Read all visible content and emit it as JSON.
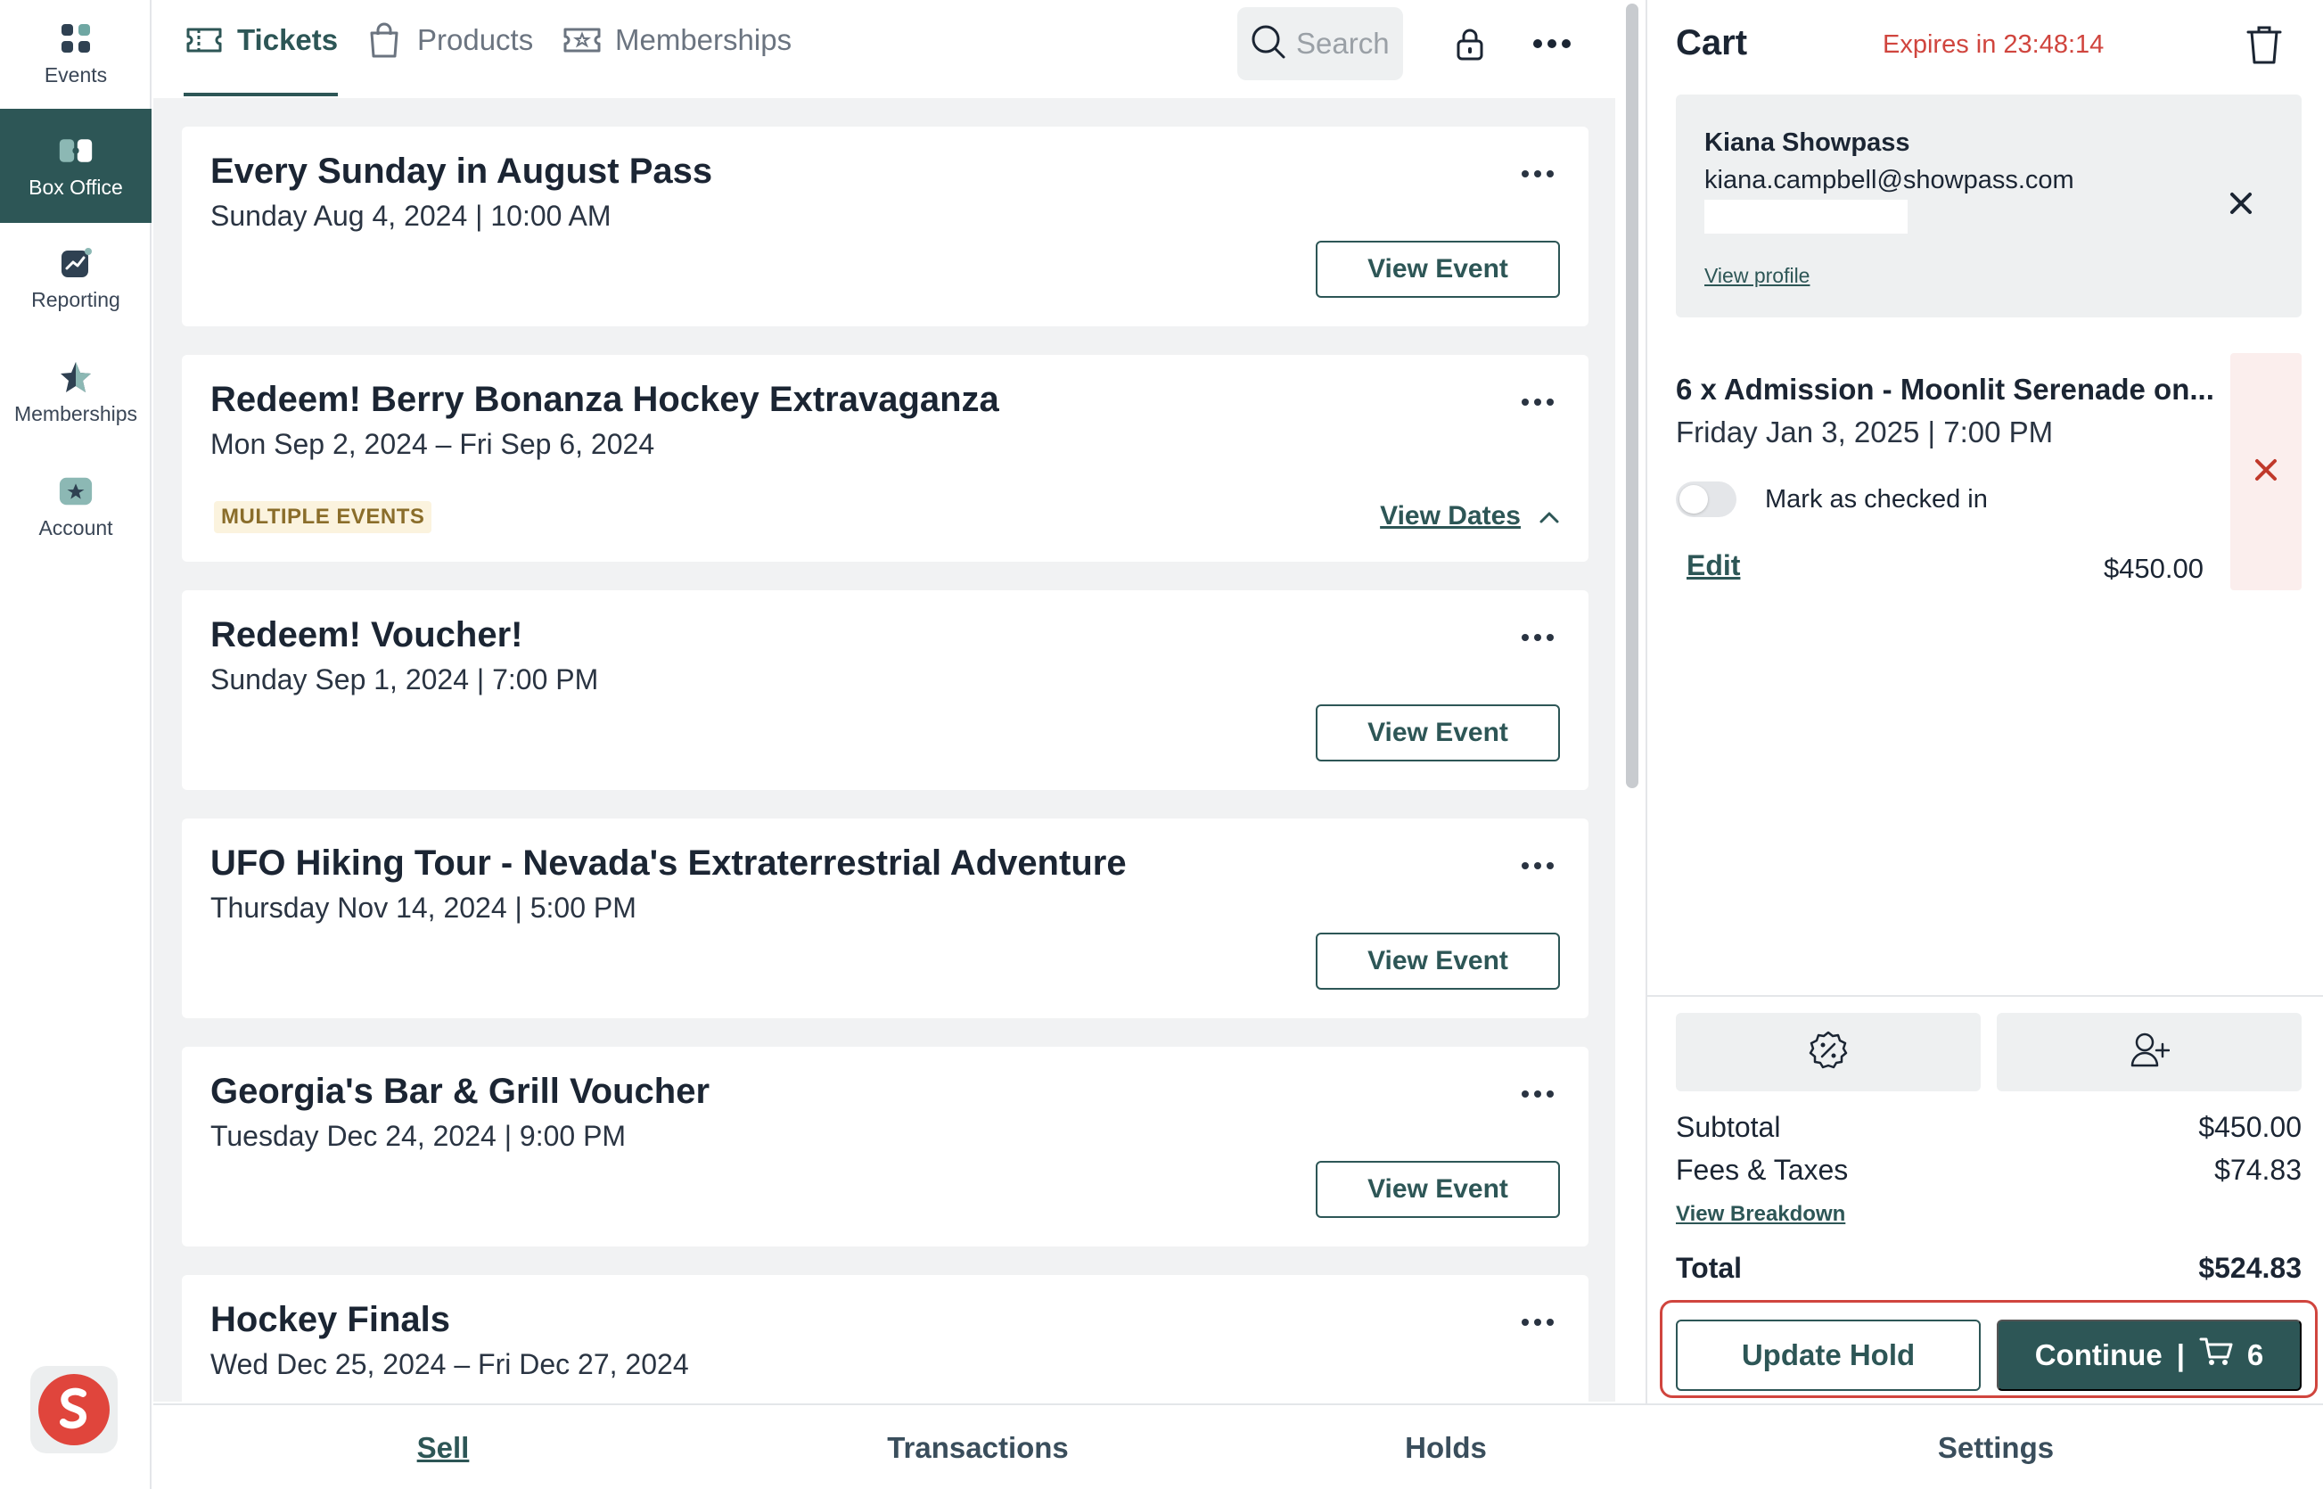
{
  "sidebar": {
    "items": [
      {
        "label": "Events",
        "icon": "grid-icon",
        "active": false
      },
      {
        "label": "Box Office",
        "icon": "box-office-icon",
        "active": true
      },
      {
        "label": "Reporting",
        "icon": "chart-icon",
        "active": false
      },
      {
        "label": "Memberships",
        "icon": "star-icon",
        "active": false
      },
      {
        "label": "Account",
        "icon": "account-icon",
        "active": false
      }
    ]
  },
  "tabs": [
    {
      "label": "Tickets",
      "icon": "ticket-icon",
      "active": true
    },
    {
      "label": "Products",
      "icon": "bag-icon",
      "active": false
    },
    {
      "label": "Memberships",
      "icon": "membership-ticket-icon",
      "active": false
    }
  ],
  "search": {
    "placeholder": "Search"
  },
  "events": [
    {
      "title": "Every Sunday in August Pass",
      "date": "Sunday Aug 4, 2024 | 10:00 AM",
      "action": "View Event"
    },
    {
      "title": "Redeem! Berry Bonanza Hockey Extravaganza",
      "date": "Mon Sep 2, 2024 – Fri Sep 6, 2024",
      "badge": "MULTIPLE EVENTS",
      "action": "View Dates"
    },
    {
      "title": "Redeem! Voucher!",
      "date": "Sunday Sep 1, 2024 | 7:00 PM",
      "action": "View Event"
    },
    {
      "title": "UFO Hiking Tour - Nevada's Extraterrestrial Adventure",
      "date": "Thursday Nov 14, 2024 | 5:00 PM",
      "action": "View Event"
    },
    {
      "title": "Georgia's Bar & Grill Voucher",
      "date": "Tuesday Dec 24, 2024 | 9:00 PM",
      "action": "View Event"
    },
    {
      "title": "Hockey Finals",
      "date": "Wed Dec 25, 2024 – Fri Dec 27, 2024",
      "action": ""
    }
  ],
  "cart": {
    "title": "Cart",
    "expires": "Expires in 23:48:14",
    "customer": {
      "name": "Kiana Showpass",
      "email": "kiana.campbell@showpass.com",
      "view_profile": "View profile"
    },
    "line_item": {
      "title": "6 x Admission - Moonlit Serenade on...",
      "date": "Friday Jan 3, 2025 | 7:00 PM",
      "checked_in_label": "Mark as checked in",
      "checked_in": false,
      "edit": "Edit",
      "price": "$450.00"
    },
    "subtotal_label": "Subtotal",
    "subtotal": "$450.00",
    "fees_label": "Fees & Taxes",
    "fees": "$74.83",
    "breakdown_link": "View Breakdown",
    "total_label": "Total",
    "total": "$524.83",
    "update_hold": "Update Hold",
    "continue_label": "Continue",
    "continue_sep": "|",
    "cart_count": "6"
  },
  "bottom_nav": [
    {
      "label": "Sell",
      "active": true
    },
    {
      "label": "Transactions",
      "active": false
    },
    {
      "label": "Holds",
      "active": false
    },
    {
      "label": "Settings",
      "active": false
    }
  ],
  "colors": {
    "brand": "#2d5656",
    "danger": "#d0453e",
    "badge_bg": "#fbf3de",
    "badge_text": "#8a6d2a"
  }
}
